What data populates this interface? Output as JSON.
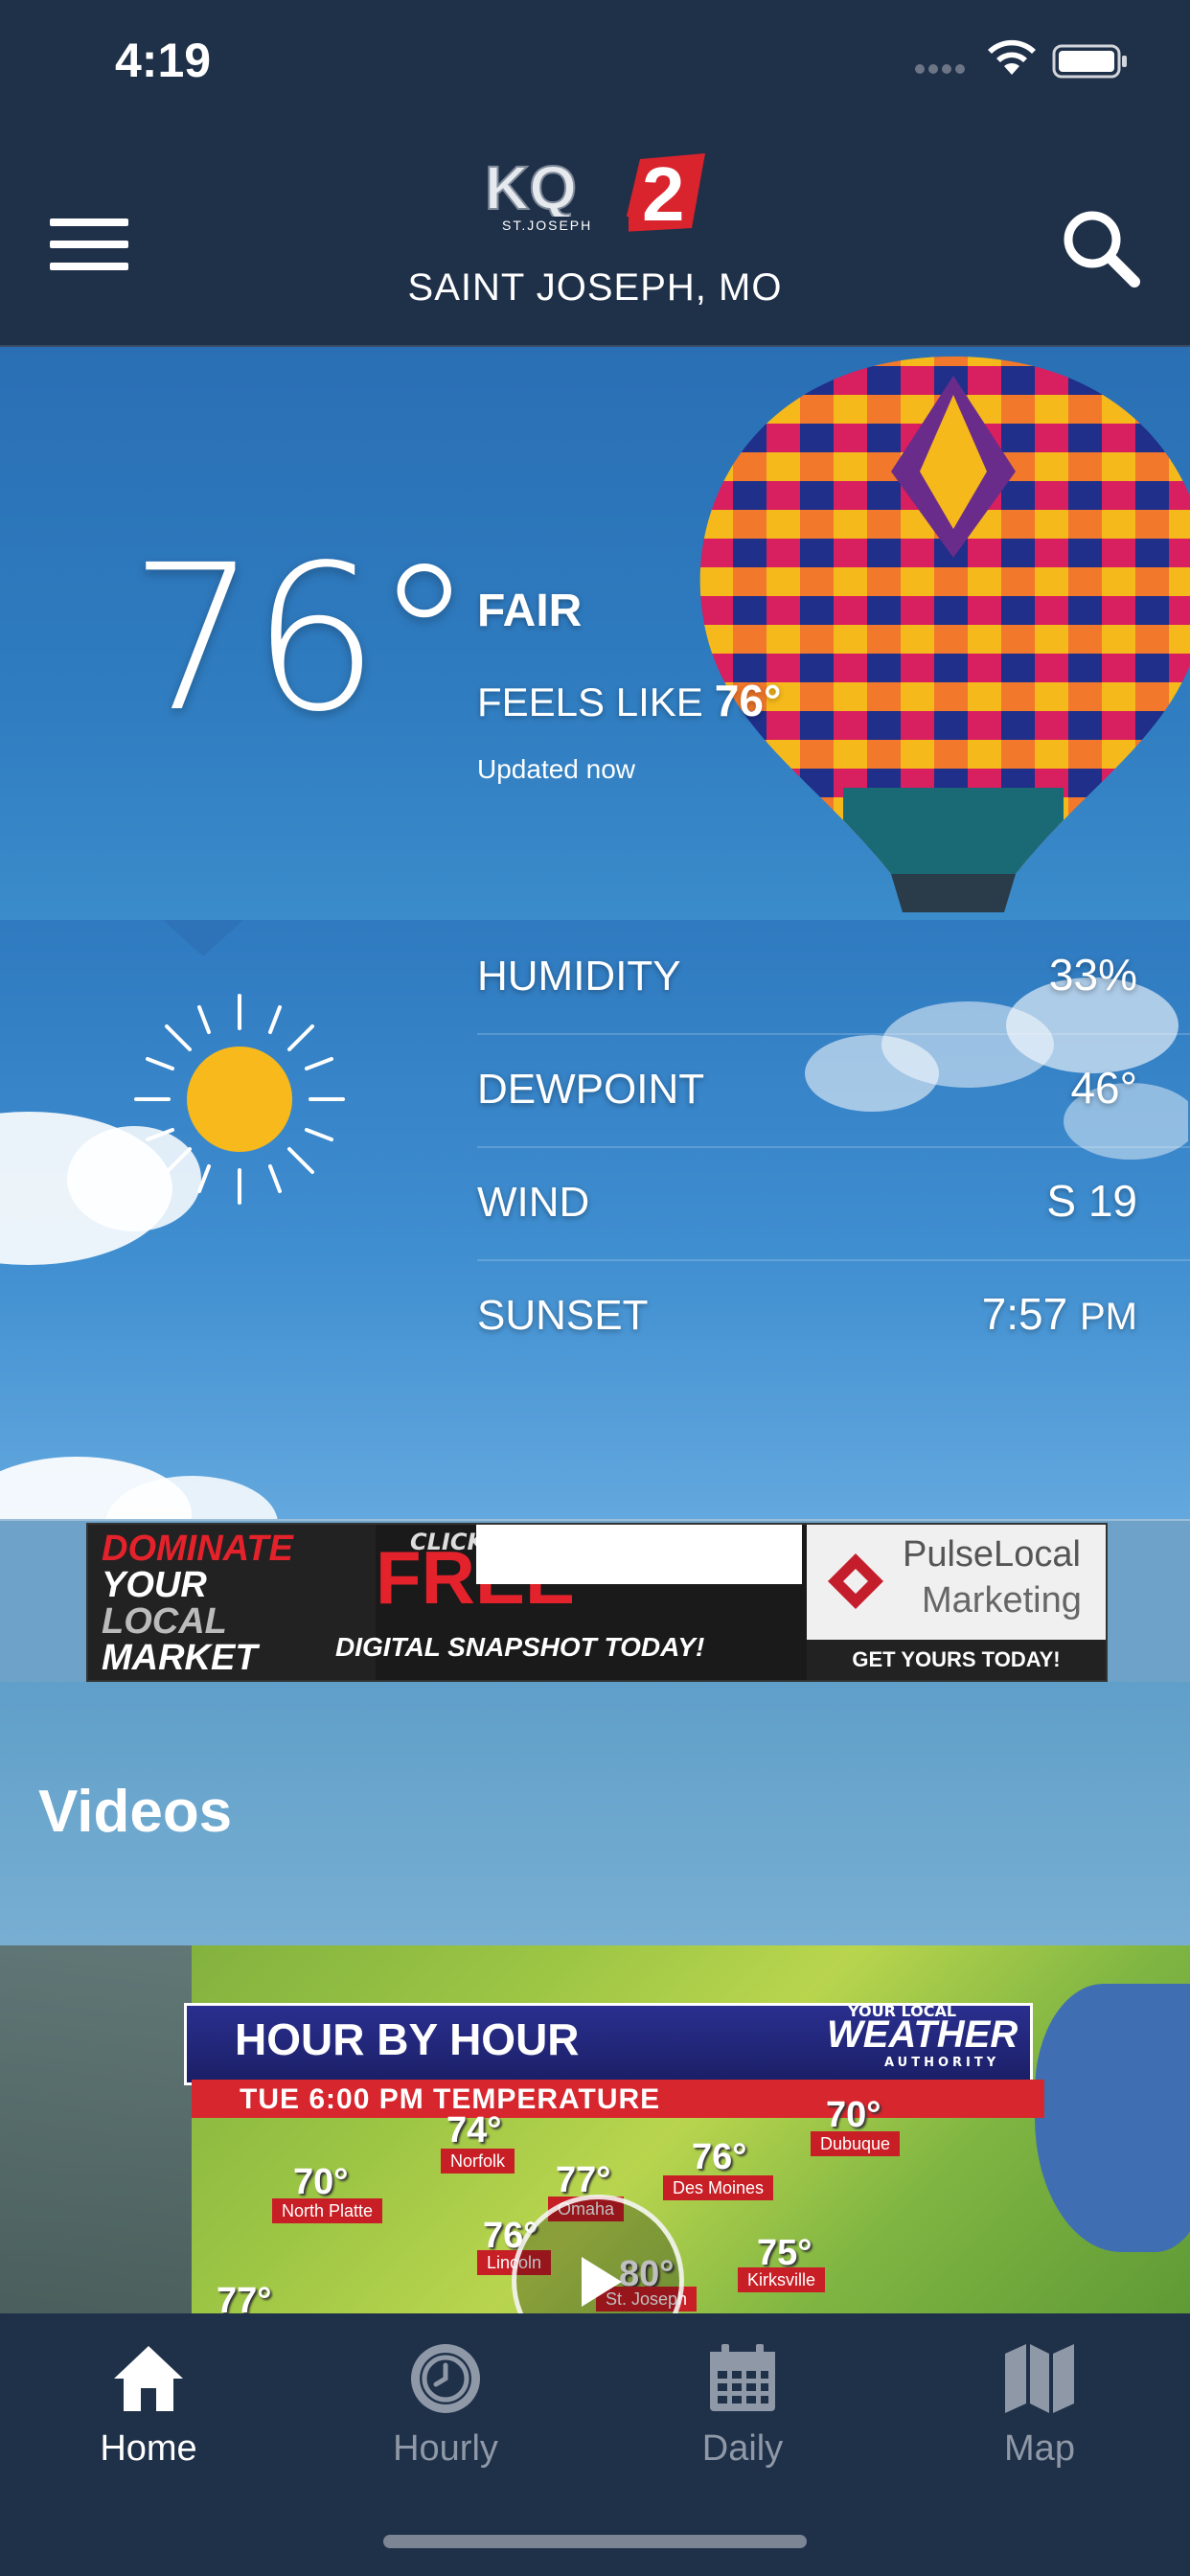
{
  "status_bar": {
    "time": "4:19"
  },
  "header": {
    "logo_text": "KQ2",
    "logo_subtext": "ST.JOSEPH",
    "location": "SAINT JOSEPH, MO"
  },
  "current": {
    "temperature": "76°",
    "condition": "FAIR",
    "feels_like_label": "FEELS LIKE",
    "feels_like_value": "76°",
    "updated": "Updated now"
  },
  "details": [
    {
      "label": "HUMIDITY",
      "value": "33%"
    },
    {
      "label": "DEWPOINT",
      "value": "46°"
    },
    {
      "label": "WIND",
      "value": "S 19"
    },
    {
      "label": "SUNSET",
      "value": "7:57",
      "unit": "PM"
    }
  ],
  "ad": {
    "left_lines": [
      "DOMINATE",
      "YOUR",
      "LOCAL",
      "MARKET"
    ],
    "click": "CLICK",
    "free": "FREE",
    "snapshot": "DIGITAL SNAPSHOT TODAY!",
    "brand_1": "PulseLocal",
    "brand_2": "Marketing",
    "cta": "GET YOURS TODAY!"
  },
  "videos": {
    "title": "Videos",
    "thumbnail": {
      "banner_title": "HOUR BY HOUR",
      "brand_top": "YOUR LOCAL",
      "brand_main": "WEATHER",
      "brand_bottom": "AUTHORITY",
      "subtitle": "TUE   6:00 PM      TEMPERATURE",
      "temps": [
        {
          "temp": "74°",
          "city": "Norfolk"
        },
        {
          "temp": "77°",
          "city": "Omaha"
        },
        {
          "temp": "76°",
          "city": "Des Moines"
        },
        {
          "temp": "70°",
          "city": "Dubuque"
        },
        {
          "temp": "70°",
          "city": "North Platte"
        },
        {
          "temp": "76°",
          "city": "Lincoln"
        },
        {
          "temp": "80°",
          "city": "St. Joseph"
        },
        {
          "temp": "75°",
          "city": "Kirksville"
        },
        {
          "temp": "77°",
          "city": ""
        }
      ]
    }
  },
  "tabs": [
    {
      "label": "Home",
      "icon": "home-icon",
      "active": true
    },
    {
      "label": "Hourly",
      "icon": "clock-icon",
      "active": false
    },
    {
      "label": "Daily",
      "icon": "calendar-icon",
      "active": false
    },
    {
      "label": "Map",
      "icon": "map-icon",
      "active": false
    }
  ],
  "colors": {
    "navy": "#1f3049",
    "sky_blue": "#2f7cc0",
    "sun": "#f7b91b",
    "tab_inactive": "#8f98a6"
  }
}
